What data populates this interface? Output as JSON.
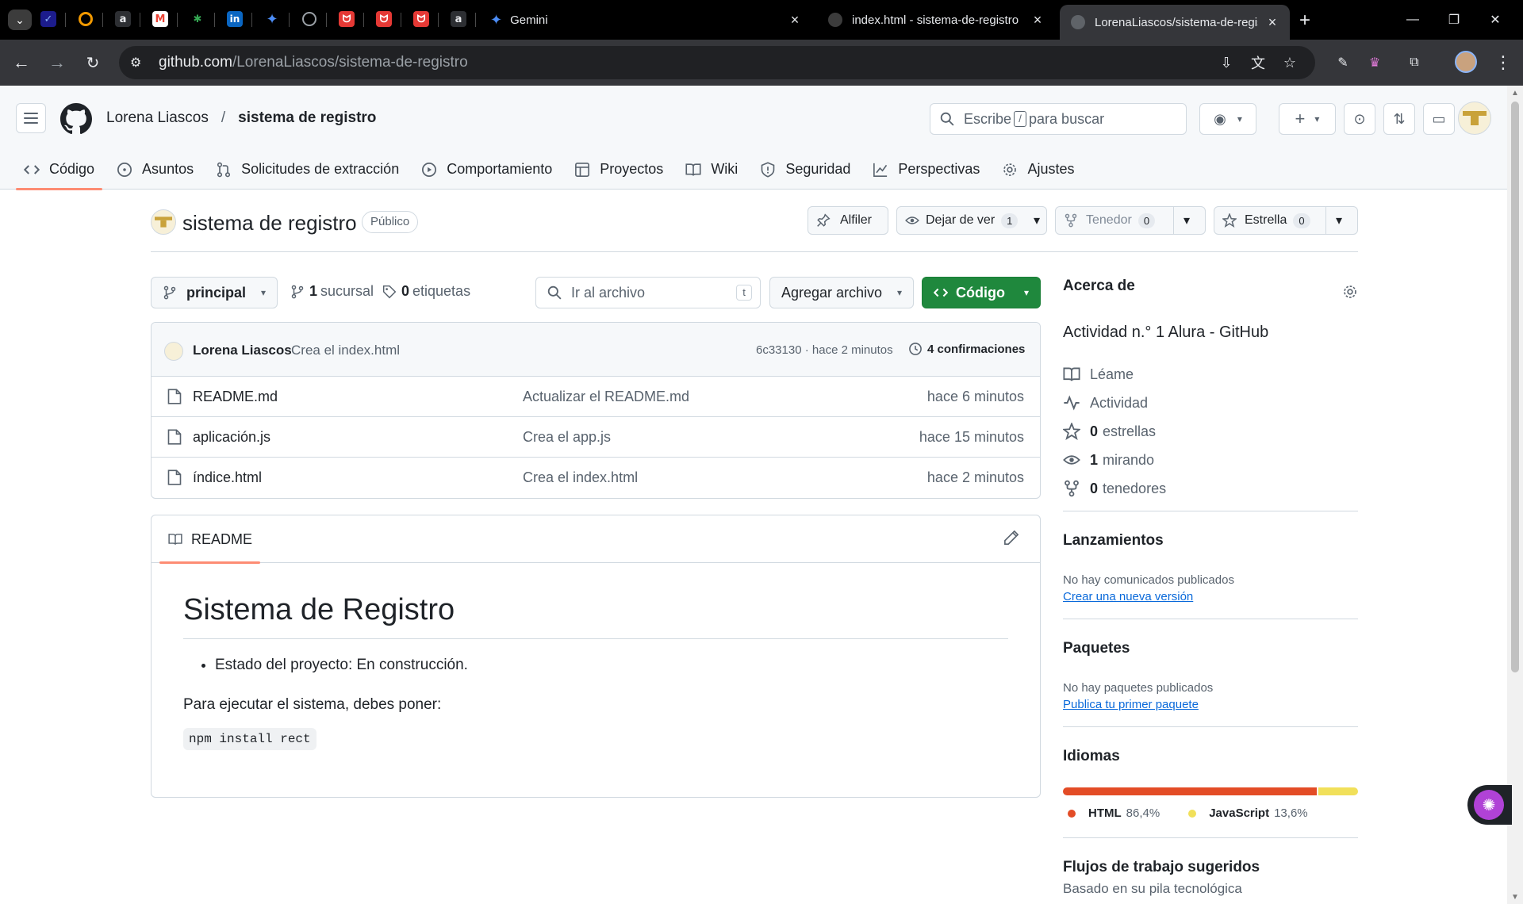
{
  "browser": {
    "tabs": [
      {
        "title": "Gemini"
      },
      {
        "title": "index.html - sistema-de-registro"
      },
      {
        "title": "LorenaLiascos/sistema-de-registro"
      }
    ],
    "new_tab_label": "+",
    "url_host": "github.com",
    "url_path": "/LorenaLiascos/sistema-de-registro"
  },
  "header": {
    "owner": "Lorena Liascos",
    "separator": "/",
    "repo": "sistema de registro",
    "search_prefix": "Escribe",
    "search_key": "/",
    "search_suffix": "para buscar"
  },
  "repo_nav": [
    {
      "label": "Código",
      "icon": "code-icon"
    },
    {
      "label": "Asuntos",
      "icon": "issue-icon"
    },
    {
      "label": "Solicitudes de extracción",
      "icon": "pull-request-icon"
    },
    {
      "label": "Comportamiento",
      "icon": "actions-play-icon"
    },
    {
      "label": "Proyectos",
      "icon": "table-icon"
    },
    {
      "label": "Wiki",
      "icon": "book-icon"
    },
    {
      "label": "Seguridad",
      "icon": "shield-icon"
    },
    {
      "label": "Perspectivas",
      "icon": "graph-icon"
    },
    {
      "label": "Ajustes",
      "icon": "gear-icon"
    }
  ],
  "repo": {
    "name": "sistema de registro",
    "visibility": "Público",
    "pin_label": "Alfiler",
    "watch_label": "Dejar de ver",
    "watch_count": "1",
    "fork_label": "Tenedor",
    "fork_count": "0",
    "star_label": "Estrella",
    "star_count": "0"
  },
  "branch_bar": {
    "branch": "principal",
    "branches_count": "1",
    "branches_label": "sucursal",
    "tags_count": "0",
    "tags_label": "etiquetas",
    "goto_placeholder": "Ir al archivo",
    "goto_key": "t",
    "add_file": "Agregar archivo",
    "code_button": "Código"
  },
  "latest_commit": {
    "author": "Lorena Liascos",
    "message": "Crea el index.html",
    "hash_time": "6c33130 · hace 2 minutos",
    "commits_count": "4",
    "commits_label": "confirmaciones"
  },
  "files": [
    {
      "name": "README.md",
      "message": "Actualizar el README.md",
      "time": "hace 6 minutos"
    },
    {
      "name": "aplicación.js",
      "message": "Crea el app.js",
      "time": "hace 15 minutos"
    },
    {
      "name": "índice.html",
      "message": "Crea el index.html",
      "time": "hace 2 minutos"
    }
  ],
  "readme": {
    "tab_label": "README",
    "h1": "Sistema de Registro",
    "bullet": "Estado del proyecto: En construcción.",
    "paragraph": "Para ejecutar el sistema, debes poner:",
    "code": "npm install rect"
  },
  "sidebar": {
    "about_title": "Acerca de",
    "description": "Actividad n.° 1 Alura - GitHub",
    "readme_link": "Léame",
    "activity_link": "Actividad",
    "stars_count": "0",
    "stars_label": "estrellas",
    "watching_count": "1",
    "watching_label": "mirando",
    "forks_count": "0",
    "forks_label": "tenedores",
    "releases_title": "Lanzamientos",
    "releases_empty": "No hay comunicados publicados",
    "releases_link": "Crear una nueva versión",
    "packages_title": "Paquetes",
    "packages_empty": "No hay paquetes publicados",
    "packages_link": "Publica tu primer paquete",
    "languages_title": "Idiomas",
    "languages": [
      {
        "name": "HTML",
        "percent_text": "86,4%",
        "percent": 86.4,
        "color": "#e34c26"
      },
      {
        "name": "JavaScript",
        "percent_text": "13,6%",
        "percent": 13.6,
        "color": "#f1e05a"
      }
    ],
    "workflows_title": "Flujos de trabajo sugeridos",
    "workflows_subtitle": "Basado en su pila tecnológica"
  },
  "colors": {
    "accent_orange": "#fd8c73",
    "green_button": "#1f883d",
    "link_blue": "#0969da"
  }
}
